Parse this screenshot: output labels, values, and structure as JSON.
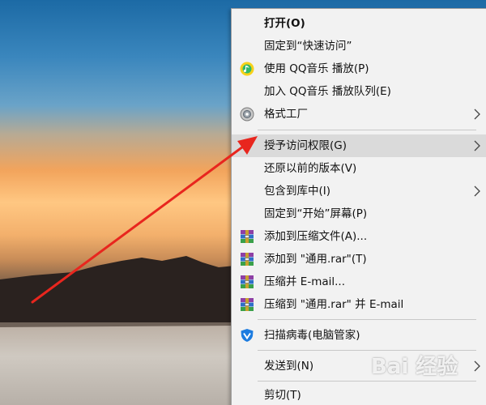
{
  "context_menu": {
    "items": [
      {
        "label": "打开(O)",
        "bold": true
      },
      {
        "label": "固定到“快速访问”"
      },
      {
        "label": "使用 QQ音乐 播放(P)",
        "icon": "qq-music-icon"
      },
      {
        "label": "加入 QQ音乐 播放队列(E)"
      },
      {
        "label": "格式工厂",
        "icon": "format-factory-icon",
        "submenu": true
      },
      {
        "label": "授予访问权限(G)",
        "submenu": true,
        "highlighted": true
      },
      {
        "label": "还原以前的版本(V)"
      },
      {
        "label": "包含到库中(I)",
        "submenu": true
      },
      {
        "label": "固定到“开始”屏幕(P)"
      },
      {
        "label": "添加到压缩文件(A)...",
        "icon": "winrar-icon"
      },
      {
        "label": "添加到 \"通用.rar\"(T)",
        "icon": "winrar-icon"
      },
      {
        "label": "压缩并 E-mail...",
        "icon": "winrar-icon"
      },
      {
        "label": "压缩到 \"通用.rar\" 并 E-mail",
        "icon": "winrar-icon"
      },
      {
        "label": "扫描病毒(电脑管家)",
        "icon": "tencent-pc-manager-icon"
      },
      {
        "label": "发送到(N)",
        "submenu": true
      },
      {
        "label": "剪切(T)"
      }
    ]
  },
  "watermark": {
    "text": "Bai 经验"
  },
  "colors": {
    "menu_background": "#f2f2f2",
    "highlight": "#dadada",
    "annotation_arrow": "#e8261e"
  }
}
